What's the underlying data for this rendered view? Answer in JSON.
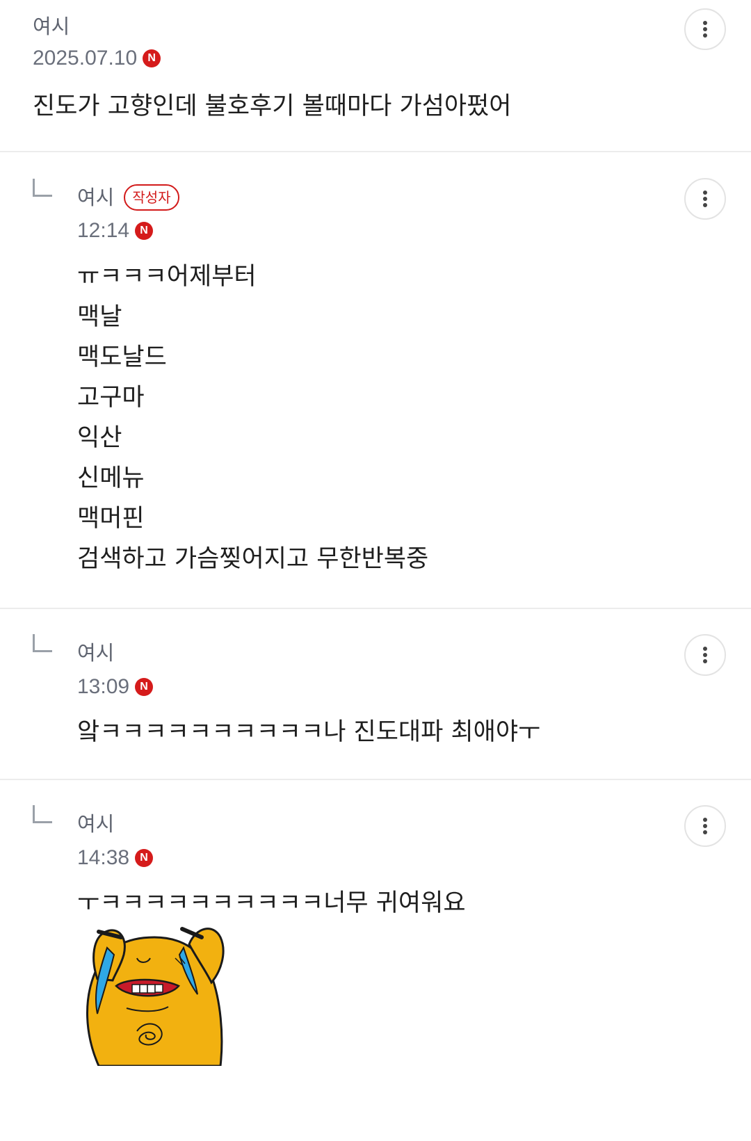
{
  "comments": [
    {
      "author": "여시",
      "timestamp": "2025.07.10",
      "new_badge": "N",
      "text": "진도가 고향인데 불호후기 볼때마다 가섬아펐어",
      "is_reply": false
    },
    {
      "author": "여시",
      "author_badge": "작성자",
      "timestamp": "12:14",
      "new_badge": "N",
      "text": "ㅠㅋㅋㅋ어제부터\n맥날\n맥도날드\n고구마\n익산\n신메뉴\n맥머핀\n검색하고 가슴찢어지고 무한반복중",
      "is_reply": true
    },
    {
      "author": "여시",
      "timestamp": "13:09",
      "new_badge": "N",
      "text": "앜ㅋㅋㅋㅋㅋㅋㅋㅋㅋㅋ나 진도대파 최애야ㅜ",
      "is_reply": true
    },
    {
      "author": "여시",
      "timestamp": "14:38",
      "new_badge": "N",
      "text": "ㅜㅋㅋㅋㅋㅋㅋㅋㅋㅋㅋ너무 귀여워요",
      "is_reply": true,
      "sticker": "crying-bear-sticker"
    }
  ],
  "icons": {
    "more": "vertical-dots-icon",
    "reply": "reply-arrow-icon"
  },
  "colors": {
    "badge_red": "#d51b1b",
    "sticker_yellow": "#f2b110",
    "tear_blue": "#2fa8e6",
    "divider": "#ececec"
  }
}
